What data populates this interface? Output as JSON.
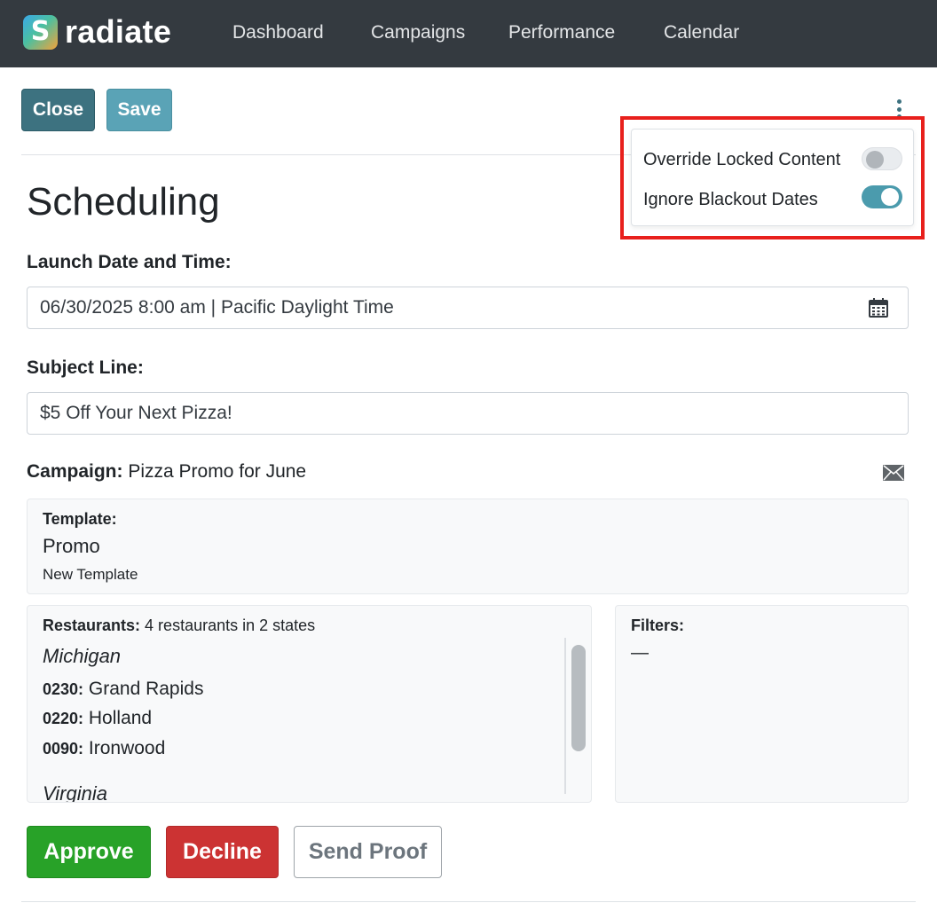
{
  "app": {
    "name": "radiate",
    "logo_glyph": "S"
  },
  "nav": {
    "items": [
      "Dashboard",
      "Campaigns",
      "Performance",
      "Calendar"
    ]
  },
  "toolbar": {
    "close_label": "Close",
    "save_label": "Save",
    "more_icon": "kebab-vertical-icon"
  },
  "options_menu": {
    "items": [
      {
        "label": "Override Locked Content",
        "enabled": false
      },
      {
        "label": "Ignore Blackout Dates",
        "enabled": true
      }
    ]
  },
  "page": {
    "title": "Scheduling"
  },
  "form": {
    "launch_label": "Launch Date and Time:",
    "launch_value": "06/30/2025 8:00 am | Pacific Daylight Time",
    "subject_label": "Subject Line:",
    "subject_value": "$5 Off Your Next Pizza!",
    "campaign_label": "Campaign:",
    "campaign_value": "Pizza Promo for June"
  },
  "template": {
    "label": "Template:",
    "name": "Promo",
    "subtitle": "New Template"
  },
  "restaurants": {
    "label": "Restaurants:",
    "summary": "4 restaurants in 2 states",
    "states": [
      {
        "name": "Michigan",
        "stores": [
          {
            "id": "0230:",
            "city": "Grand Rapids"
          },
          {
            "id": "0220:",
            "city": "Holland"
          },
          {
            "id": "0090:",
            "city": "Ironwood"
          }
        ]
      },
      {
        "name": "Virginia",
        "stores": []
      }
    ]
  },
  "filters": {
    "label": "Filters:",
    "value": "—"
  },
  "actions": {
    "approve_label": "Approve",
    "decline_label": "Decline",
    "proof_label": "Send Proof"
  },
  "colors": {
    "nav_bg": "#343a40",
    "primary": "#3d7280",
    "toggle_on": "#4b9bad",
    "approve": "#28a228",
    "decline": "#cc3333",
    "highlight": "#e8201c"
  }
}
